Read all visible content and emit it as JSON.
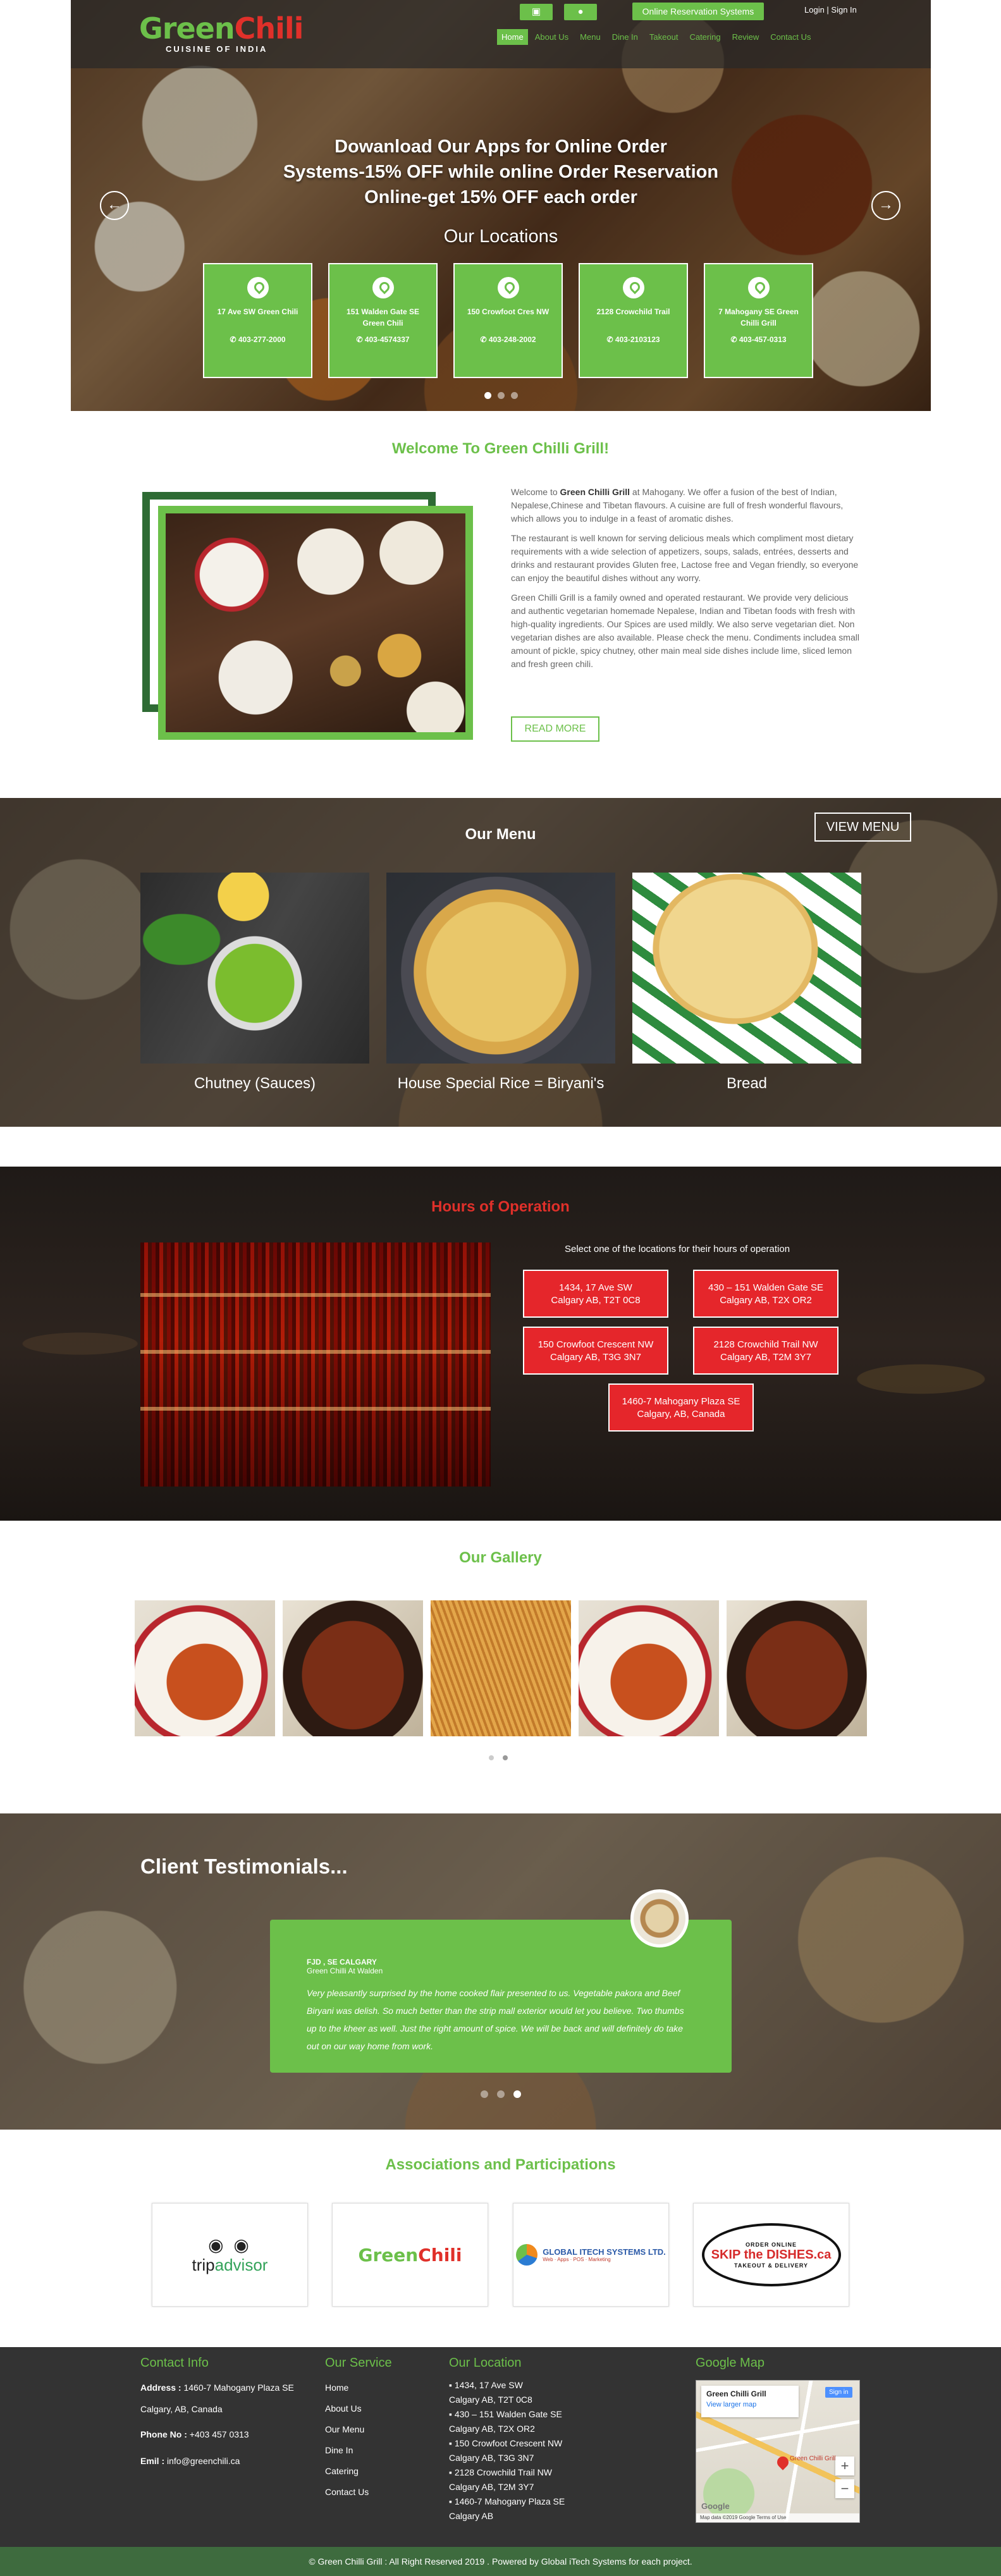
{
  "header": {
    "logo_main": "Green",
    "logo_chili": "Chili",
    "logo_sub": "CUISINE OF INDIA",
    "android_icon": "android-icon",
    "apple_icon": "apple-icon",
    "reserve_label": "Online Reservation Systems",
    "login_label": "Login | Sign In",
    "nav": [
      "Home",
      "About Us",
      "Menu",
      "Dine In",
      "Takeout",
      "Catering",
      "Review",
      "Contact Us"
    ]
  },
  "hero": {
    "promo_line1": "Dowanload Our Apps for Online Order",
    "promo_line2": "Systems-15% OFF while online Order Reservation",
    "promo_line3": "Online-get 15% OFF each order",
    "locations_title": "Our Locations",
    "prev_arrow": "←",
    "next_arrow": "→",
    "locations": [
      {
        "name": "17 Ave SW Green Chili",
        "phone": "✆ 403-277-2000"
      },
      {
        "name": "151 Walden Gate SE Green Chili",
        "phone": "✆ 403-4574337"
      },
      {
        "name": "150 Crowfoot Cres NW",
        "phone": "✆ 403-248-2002"
      },
      {
        "name": "2128 Crowchild Trail",
        "phone": "✆ 403-2103123"
      },
      {
        "name": "7 Mahogany SE Green Chilli Grill",
        "phone": "✆ 403-457-0313"
      }
    ]
  },
  "welcome": {
    "title": "Welcome To Green Chilli Grill!",
    "p1_pre": "Welcome to ",
    "p1_bold": "Green Chilli Grill",
    "p1_post": " at Mahogany. We offer a fusion of the best of Indian, Nepalese,Chinese and Tibetan flavours. A cuisine are full of fresh wonderful flavours, which allows you to indulge in a feast of aromatic dishes.",
    "p2": "The restaurant is well known for serving delicious meals which compliment most dietary requirements with a wide selection of appetizers, soups, salads, entrées, desserts and drinks and restaurant provides Gluten free, Lactose free and Vegan friendly, so everyone can enjoy the beautiful dishes without any worry.",
    "p3": "Green Chilli Grill is a family owned and operated restaurant. We provide very delicious and authentic vegetarian homemade Nepalese, Indian and Tibetan foods with fresh with high-quality ingredients. Our Spices are used mildly. We also serve vegetarian diet. Non vegetarian dishes are also available. Please check the menu. Condiments includea small amount of pickle, spicy chutney, other main meal side dishes include lime, sliced lemon and fresh green chili.",
    "read_more": "READ MORE"
  },
  "menu": {
    "title": "Our Menu",
    "view_menu": "VIEW MENU",
    "items": [
      "Chutney (Sauces)",
      "House Special Rice = Biryani's",
      "Bread"
    ]
  },
  "hours": {
    "title": "Hours of Operation",
    "subtitle": "Select one of the locations for their hours of operation",
    "locations": [
      {
        "line1": "1434, 17 Ave SW",
        "line2": "Calgary AB, T2T 0C8"
      },
      {
        "line1": "430 – 151 Walden Gate SE",
        "line2": "Calgary AB, T2X OR2"
      },
      {
        "line1": "150 Crowfoot Crescent NW",
        "line2": "Calgary AB, T3G 3N7"
      },
      {
        "line1": "2128 Crowchild Trail NW",
        "line2": "Calgary AB, T2M 3Y7"
      },
      {
        "line1": "1460-7 Mahogany Plaza SE",
        "line2": "Calgary, AB, Canada"
      }
    ]
  },
  "gallery": {
    "title": "Our Gallery"
  },
  "testimonials": {
    "title": "Client Testimonials...",
    "name": "FJD , SE CALGARY",
    "location": "Green Chilli At Walden",
    "quote": "Very pleasantly surprised by the home cooked flair presented to us. Vegetable pakora and Beef Biryani was delish. So much better than the strip mall exterior would let you believe. Two thumbs up to the kheer as well. Just the right amount of spice. We will be back and will definitely do take out on our way home from work."
  },
  "associations": {
    "title": "Associations and Participations",
    "tripadvisor_owl": "◉ ◉",
    "tripadvisor_trip": "trip",
    "tripadvisor_advisor": "advisor",
    "greenchili_green": "Green",
    "greenchili_chili": "Chili",
    "globalitech_name": "GLOBAL ITECH SYSTEMS LTD.",
    "globalitech_tag": "Web · Apps · POS · Marketing",
    "skip_top": "ORDER ONLINE",
    "skip_main": "SKIP the DISHES.ca",
    "skip_bottom": "TAKEOUT & DELIVERY"
  },
  "footer": {
    "contact_title": "Contact Info",
    "address_label": "Address :",
    "address_value": "1460-7 Mahogany Plaza SE",
    "address_city": "Calgary, AB, Canada",
    "phone_label": "Phone No :",
    "phone_value": "+403 457 0313",
    "email_label": "Emil :",
    "email_value": "info@greenchili.ca",
    "service_title": "Our Service",
    "services": [
      "Home",
      "About Us",
      "Our Menu",
      "Dine In",
      "Catering",
      "Contact Us"
    ],
    "location_title": "Our Location",
    "locations": [
      "1434, 17 Ave SW",
      "Calgary AB, T2T 0C8",
      "430 – 151 Walden Gate SE",
      "Calgary AB, T2X OR2",
      "150 Crowfoot Crescent NW",
      "Calgary AB, T3G 3N7",
      "2128 Crowchild Trail NW",
      "Calgary AB, T2M 3Y7",
      "1460-7 Mahogany Plaza SE",
      "Calgary AB"
    ],
    "map_title": "Google Map",
    "map_place": "Green Chilli Grill",
    "map_link": "View larger map",
    "map_signin": "Sign in",
    "map_pin_label": "Green Chilli Grill",
    "map_google": "Google",
    "map_footer": "Map data ©2019 Google   Terms of Use",
    "copyright": "© Green Chilli Grill : All Right Reserved 2019 . Powered by Global iTech Systems for each project."
  },
  "colors": {
    "brand_green": "#6cc04a",
    "accent_red": "#e5262b",
    "footer_bg": "#333333",
    "copyright_bg": "#3e6b3e"
  }
}
